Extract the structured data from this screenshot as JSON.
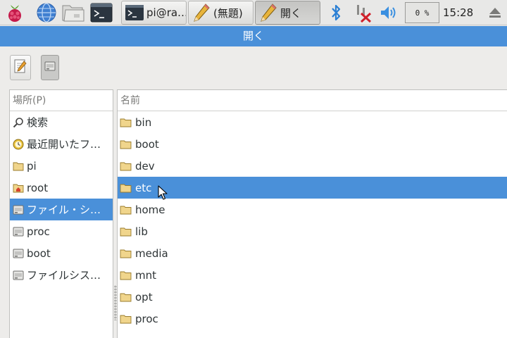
{
  "taskbar": {
    "launchers": [
      {
        "name": "raspberry-menu-icon"
      },
      {
        "name": "web-browser-icon"
      },
      {
        "name": "file-manager-icon"
      },
      {
        "name": "terminal-icon"
      }
    ],
    "tasks": [
      {
        "label": "pi@ra…",
        "icon": "terminal-icon",
        "active": false
      },
      {
        "label": "(無題)",
        "icon": "pencil-icon",
        "active": false
      },
      {
        "label": "開く",
        "icon": "pencil-icon",
        "active": true
      }
    ],
    "cpu_label": "0 %",
    "clock": "15:28"
  },
  "dialog": {
    "title": "開く"
  },
  "places": {
    "header": "場所(P)",
    "items": [
      {
        "label": "検索",
        "icon": "search-icon"
      },
      {
        "label": "最近開いたフ…",
        "icon": "recent-clock-icon"
      },
      {
        "label": "pi",
        "icon": "folder-icon"
      },
      {
        "label": "root",
        "icon": "home-folder-icon"
      },
      {
        "label": "ファイル・シ…",
        "icon": "drive-icon",
        "selected": true
      },
      {
        "label": "proc",
        "icon": "drive-icon"
      },
      {
        "label": "boot",
        "icon": "drive-icon"
      },
      {
        "label": "ファイルシス…",
        "icon": "drive-icon"
      }
    ]
  },
  "files": {
    "header": "名前",
    "items": [
      {
        "label": "bin"
      },
      {
        "label": "boot"
      },
      {
        "label": "dev"
      },
      {
        "label": "etc",
        "selected": true
      },
      {
        "label": "home"
      },
      {
        "label": "lib"
      },
      {
        "label": "media"
      },
      {
        "label": "mnt"
      },
      {
        "label": "opt"
      },
      {
        "label": "proc"
      }
    ]
  },
  "colors": {
    "accent": "#4a90d9",
    "folder": "#f0d58c"
  }
}
